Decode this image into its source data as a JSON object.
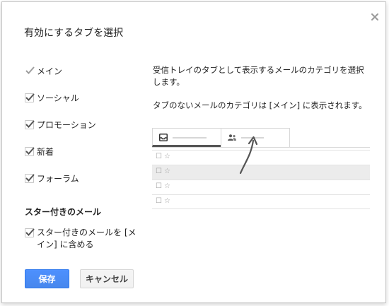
{
  "dialog": {
    "title": "有効にするタブを選択"
  },
  "categories": [
    {
      "label": "メイン",
      "checked": true,
      "disabled": true
    },
    {
      "label": "ソーシャル",
      "checked": true,
      "disabled": false
    },
    {
      "label": "プロモーション",
      "checked": true,
      "disabled": false
    },
    {
      "label": "新着",
      "checked": true,
      "disabled": false
    },
    {
      "label": "フォーラム",
      "checked": true,
      "disabled": false
    }
  ],
  "starred": {
    "section_title": "スター付きのメール",
    "option_label": "スター付きのメールを [メイン] に含める",
    "checked": true
  },
  "description": {
    "line1": "受信トレイのタブとして表示するメールのカテゴリを選択します。",
    "line2": "タブのないメールのカテゴリは [メイン] に表示されます。"
  },
  "preview": {
    "tabs": [
      {
        "icon": "inbox-icon",
        "active": true
      },
      {
        "icon": "people-icon",
        "active": false
      }
    ],
    "row_glyphs": "☐☆",
    "rows": [
      {
        "read": false
      },
      {
        "read": true
      },
      {
        "read": false
      },
      {
        "read": false
      }
    ]
  },
  "buttons": {
    "save": "保存",
    "cancel": "キャンセル"
  },
  "colors": {
    "primary": "#4d90fe",
    "checkmark": "#555555",
    "disabled_checkmark": "#9e9e9e"
  }
}
